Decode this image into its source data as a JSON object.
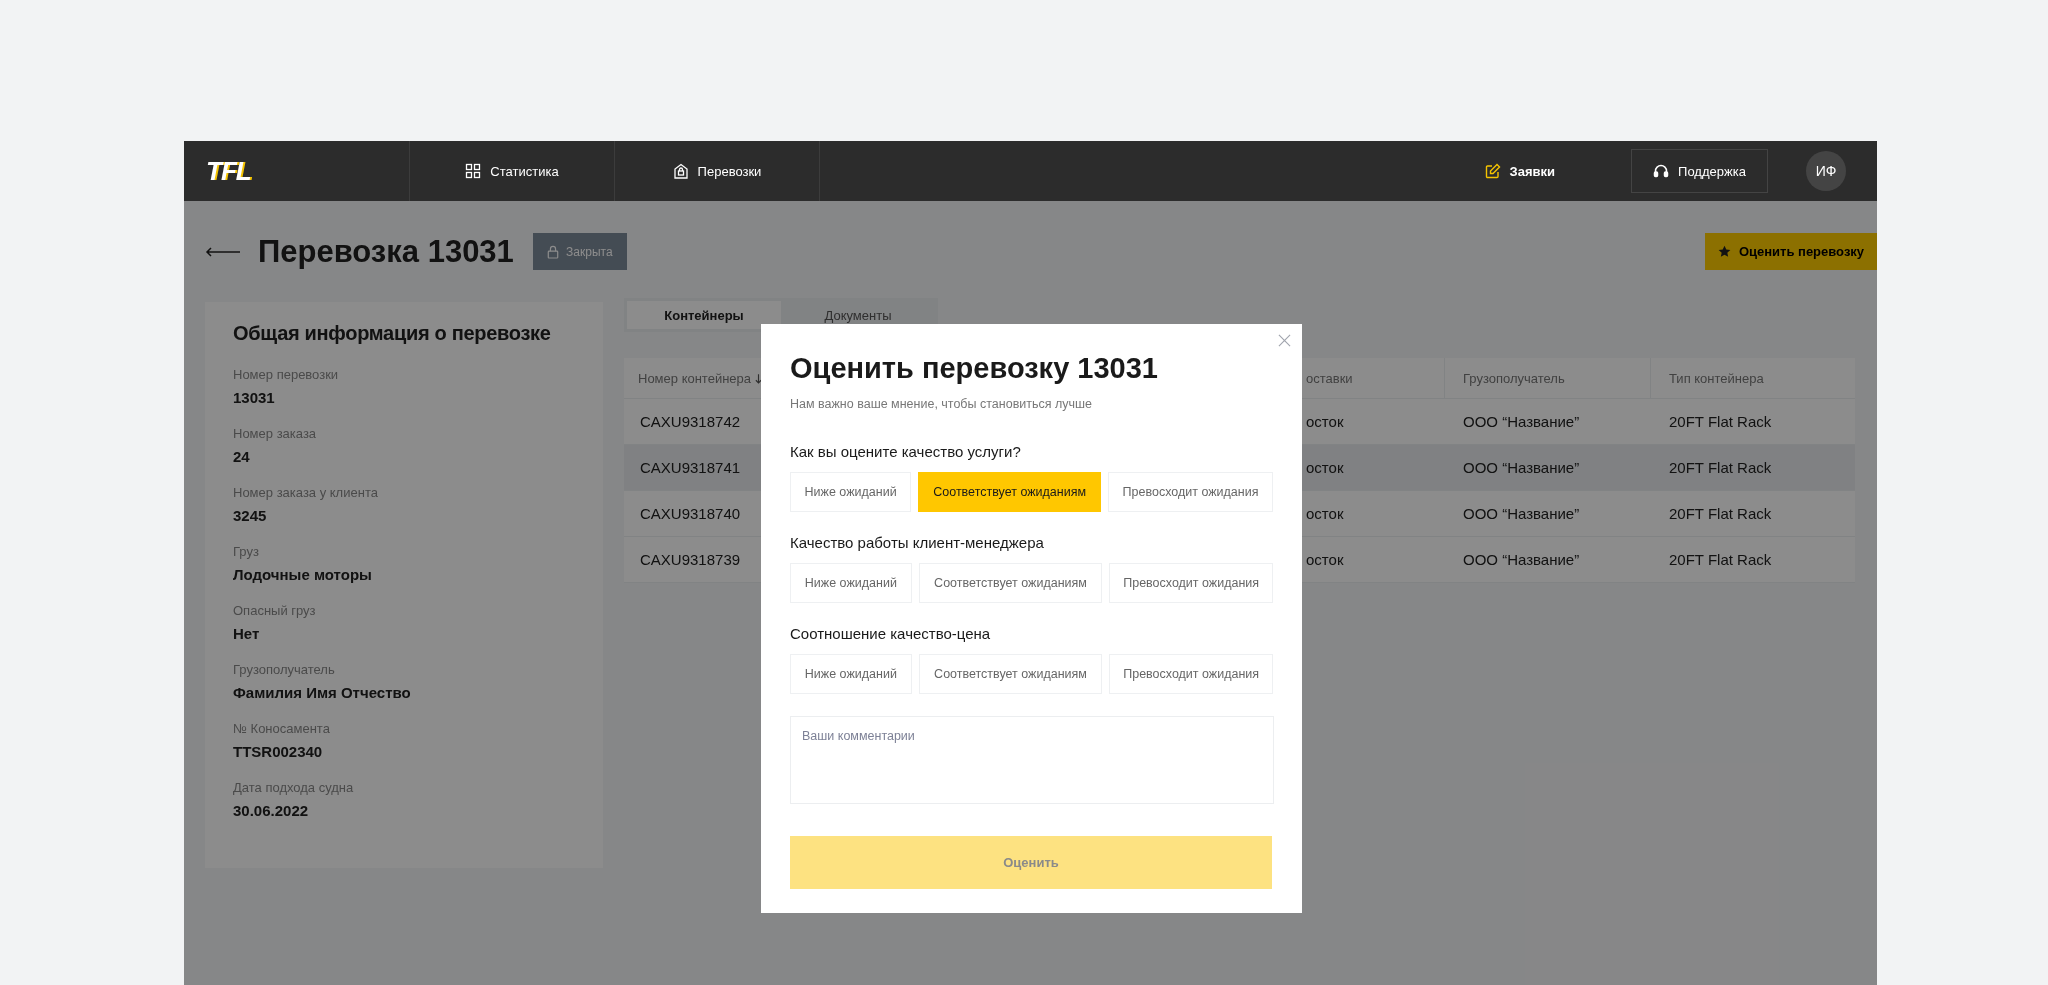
{
  "header": {
    "logo": "TFL",
    "nav": [
      {
        "label": "Статистика"
      },
      {
        "label": "Перевозки"
      }
    ],
    "requests": {
      "label": "Заявки"
    },
    "support": {
      "label": "Поддержка"
    },
    "avatar": "ИФ"
  },
  "page": {
    "title": "Перевозка 13031",
    "status": "Закрыта",
    "rate_button": "Оценить перевозку"
  },
  "info_card": {
    "title": "Общая информация о перевозке",
    "fields": [
      {
        "label": "Номер перевозки",
        "value": "13031"
      },
      {
        "label": "Номер заказа",
        "value": "24"
      },
      {
        "label": "Номер заказа у клиента",
        "value": "3245"
      },
      {
        "label": "Груз",
        "value": "Лодочные моторы"
      },
      {
        "label": "Опасный груз",
        "value": "Нет"
      },
      {
        "label": "Грузополучатель",
        "value": "Фамилия Имя Отчество"
      },
      {
        "label": "№ Коносамента",
        "value": "TTSR002340"
      },
      {
        "label": "Дата подхода судна",
        "value": "30.06.2022"
      }
    ]
  },
  "tabs": [
    {
      "label": "Контейнеры",
      "selected": true
    },
    {
      "label": "Документы",
      "selected": false
    }
  ],
  "table": {
    "columns": [
      {
        "label": "Номер контейнера",
        "sorted": true
      },
      {
        "label": "оставки",
        "sorted": false
      },
      {
        "label": "Грузополучатель",
        "sorted": false
      },
      {
        "label": "Тип контейнера",
        "sorted": false
      }
    ],
    "rows": [
      {
        "cells": [
          "CAXU9318742",
          "осток",
          "ООО “Название”",
          "20FT Flat Rack"
        ],
        "selected": false
      },
      {
        "cells": [
          "CAXU9318741",
          "осток",
          "ООО “Название”",
          "20FT Flat Rack"
        ],
        "selected": true
      },
      {
        "cells": [
          "CAXU9318740",
          "осток",
          "ООО “Название”",
          "20FT Flat Rack"
        ],
        "selected": false
      },
      {
        "cells": [
          "CAXU9318739",
          "осток",
          "ООО “Название”",
          "20FT Flat Rack"
        ],
        "selected": false
      }
    ]
  },
  "modal": {
    "title": "Оценить перевозку 13031",
    "subtitle": "Нам важно ваше мнение, чтобы становиться лучше",
    "questions": [
      {
        "label": "Как вы оцените качество услуги?",
        "options": [
          {
            "label": "Ниже ожиданий",
            "selected": false
          },
          {
            "label": "Соответствует ожиданиям",
            "selected": true
          },
          {
            "label": "Превосходит ожидания",
            "selected": false
          }
        ]
      },
      {
        "label": "Качество работы клиент-менеджера",
        "options": [
          {
            "label": "Ниже ожиданий",
            "selected": false
          },
          {
            "label": "Соответствует ожиданиям",
            "selected": false
          },
          {
            "label": "Превосходит ожидания",
            "selected": false
          }
        ]
      },
      {
        "label": "Соотношение качество-цена",
        "options": [
          {
            "label": "Ниже ожиданий",
            "selected": false
          },
          {
            "label": "Соответствует ожиданиям",
            "selected": false
          },
          {
            "label": "Превосходит ожидания",
            "selected": false
          }
        ]
      }
    ],
    "comment": {
      "placeholder": "Ваши комментарии"
    },
    "submit": {
      "label": "Оценить",
      "disabled": true
    }
  }
}
